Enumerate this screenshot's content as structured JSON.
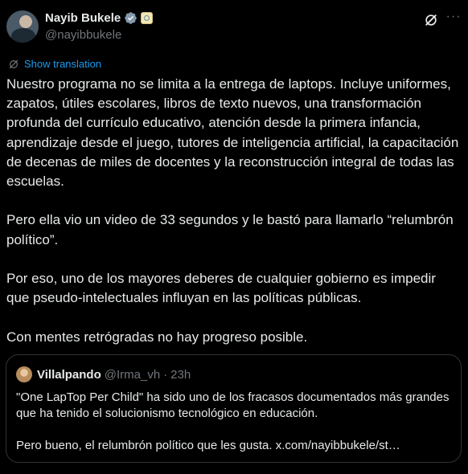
{
  "author": {
    "display_name": "Nayib Bukele",
    "handle": "@nayibbukele"
  },
  "translate": {
    "label": "Show translation"
  },
  "tweet": {
    "paragraphs": [
      "Nuestro programa no se limita a la entrega de laptops. Incluye uniformes, zapatos, útiles escolares, libros de texto nuevos, una transformación profunda del currículo educativo, atención desde la primera infancia, aprendizaje desde el juego, tutores de inteligencia artificial, la capacitación de decenas de miles de docentes y la reconstrucción integral de todas las escuelas.",
      "Pero ella vio un video de 33 segundos y le bastó para llamarlo “relumbrón político”.",
      "Por eso, uno de los mayores deberes de cualquier gobierno es impedir que pseudo-intelectuales influyan en las políticas públicas.",
      "Con mentes retrógradas no hay progreso posible."
    ]
  },
  "quote": {
    "display_name": "Villalpando",
    "handle": "@Irma_vh",
    "separator": "·",
    "time": "23h",
    "paragraphs": [
      "\"One LapTop Per Child\" ha sido uno de los fracasos documentados más grandes que ha tenido el solucionismo tecnológico en educación.",
      "Pero bueno, el relumbrón político que les gusta. x.com/nayibbukele/st…"
    ]
  },
  "icons": {
    "verified": "verified-badge-icon",
    "affiliation": "affiliation-badge-icon",
    "grok": "grok-icon",
    "more": "more-options-icon",
    "translate": "translate-icon"
  },
  "colors": {
    "background": "#000000",
    "text": "#e7e9ea",
    "muted": "#71767b",
    "accent": "#1d9bf0",
    "border": "#2f3336"
  }
}
